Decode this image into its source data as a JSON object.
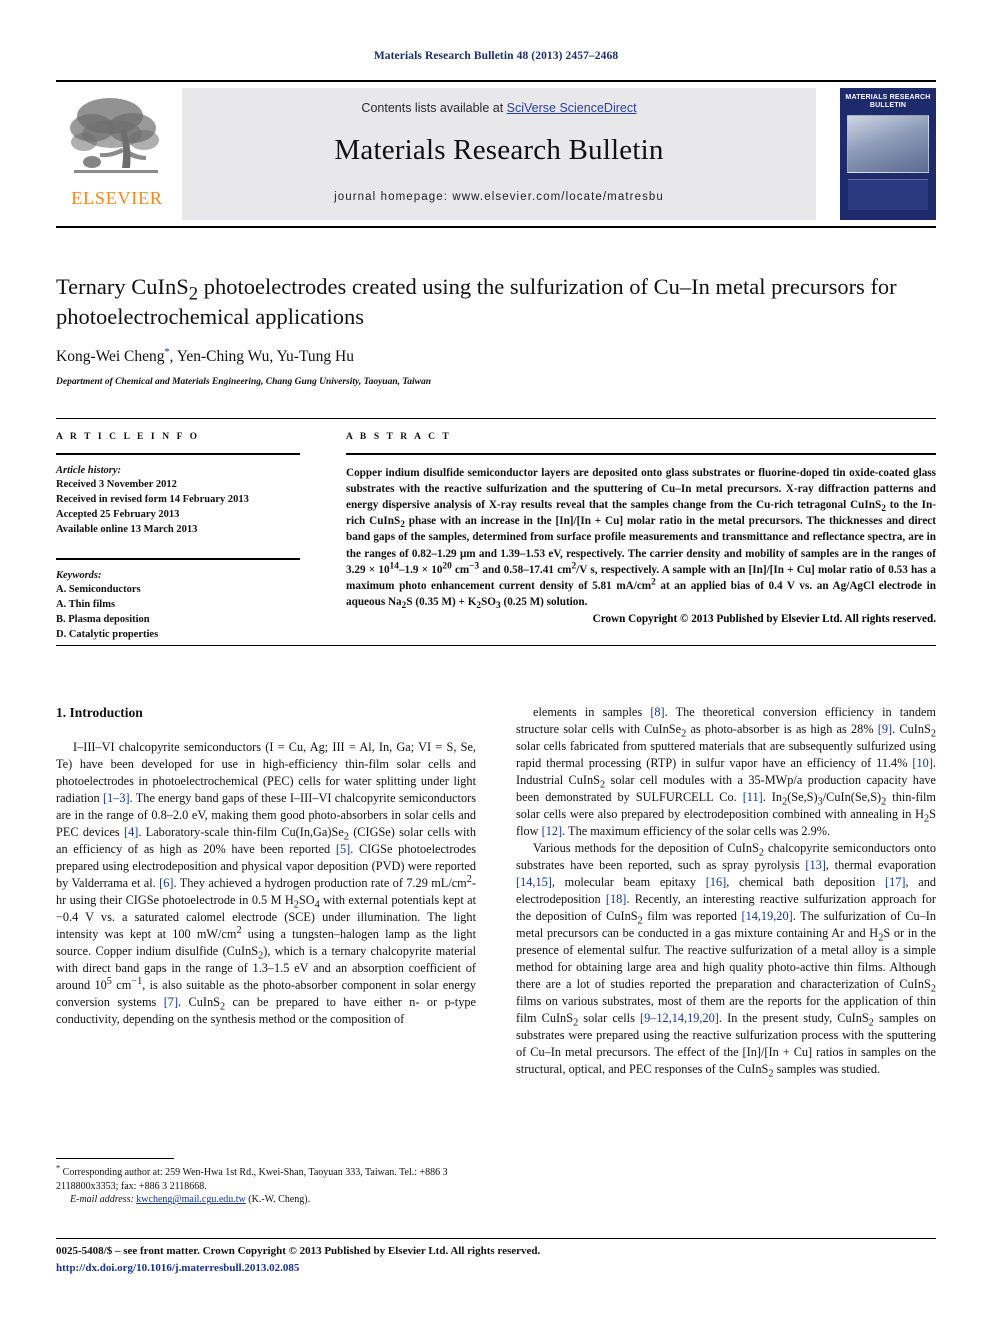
{
  "running_head": "Materials Research Bulletin 48 (2013) 2457–2468",
  "masthead": {
    "contents_prefix": "Contents lists available at ",
    "sciencedirect": "SciVerse ScienceDirect",
    "journal_title": "Materials Research Bulletin",
    "homepage_label": "journal homepage: www.elsevier.com/locate/matresbu",
    "publisher_name": "ELSEVIER",
    "cover_title": "MATERIALS RESEARCH BULLETIN"
  },
  "article": {
    "title_part1": "Ternary CuInS",
    "title_sub": "2",
    "title_part2": " photoelectrodes created using the sulfurization of Cu–In metal precursors for photoelectrochemical applications",
    "authors": "Kong-Wei Cheng",
    "corresponding_marker": "*",
    "authors_rest": ", Yen-Ching Wu, Yu-Tung Hu",
    "affiliation": "Department of Chemical and Materials Engineering, Chang Gung University, Taoyuan, Taiwan"
  },
  "article_info": {
    "heading": "A R T I C L E   I N F O",
    "history_label": "Article history:",
    "history": [
      "Received 3 November 2012",
      "Received in revised form 14 February 2013",
      "Accepted 25 February 2013",
      "Available online 13 March 2013"
    ],
    "keywords_label": "Keywords:",
    "keywords": [
      "A. Semiconductors",
      "A. Thin films",
      "B. Plasma deposition",
      "D. Catalytic properties"
    ]
  },
  "abstract": {
    "heading": "A B S T R A C T",
    "text": "Copper indium disulfide semiconductor layers are deposited onto glass substrates or fluorine-doped tin oxide-coated glass substrates with the reactive sulfurization and the sputtering of Cu–In metal precursors. X-ray diffraction patterns and energy dispersive analysis of X-ray results reveal that the samples change from the Cu-rich tetragonal CuInS2 to the In-rich CuInS2 phase with an increase in the [In]/[In + Cu] molar ratio in the metal precursors. The thicknesses and direct band gaps of the samples, determined from surface profile measurements and transmittance and reflectance spectra, are in the ranges of 0.82–1.29 μm and 1.39–1.53 eV, respectively. The carrier density and mobility of samples are in the ranges of 3.29 × 1014–1.9 × 1020 cm−3 and 0.58–17.41 cm2/V s, respectively. A sample with an [In]/[In + Cu] molar ratio of 0.53 has a maximum photo enhancement current density of 5.81 mA/cm2 at an applied bias of 0.4 V vs. an Ag/AgCl electrode in aqueous Na2S (0.35 M) + K2SO3 (0.25 M) solution.",
    "copyright": "Crown Copyright © 2013 Published by Elsevier Ltd. All rights reserved."
  },
  "intro": {
    "heading": "1. Introduction",
    "left_paragraph": "I–III–VI chalcopyrite semiconductors (I = Cu, Ag; III = Al, In, Ga; VI = S, Se, Te) have been developed for use in high-efficiency thin-film solar cells and photoelectrodes in photoelectrochemical (PEC) cells for water splitting under light radiation [1–3]. The energy band gaps of these I–III–VI chalcopyrite semiconductors are in the range of 0.8–2.0 eV, making them good photo-absorbers in solar cells and PEC devices [4]. Laboratory-scale thin-film Cu(In,Ga)Se2 (CIGSe) solar cells with an efficiency of as high as 20% have been reported [5]. CIGSe photoelectrodes prepared using electrodeposition and physical vapor deposition (PVD) were reported by Valderrama et al. [6]. They achieved a hydrogen production rate of 7.29 mL/cm2-hr using their CIGSe photoelectrode in 0.5 M H2SO4 with external potentials kept at −0.4 V vs. a saturated calomel electrode (SCE) under illumination. The light intensity was kept at 100 mW/cm2 using a tungsten–halogen lamp as the light source. Copper indium disulfide (CuInS2), which is a ternary chalcopyrite material with direct band gaps in the range of 1.3–1.5 eV and an absorption coefficient of around 105 cm−1, is also suitable as the photo-absorber component in solar energy conversion systems [7]. CuInS2 can be prepared to have either n- or p-type conductivity, depending on the synthesis method or the composition of",
    "right_paragraph_1": "elements in samples [8]. The theoretical conversion efficiency in tandem structure solar cells with CuInSe2 as photo-absorber is as high as 28% [9]. CuInS2 solar cells fabricated from sputtered materials that are subsequently sulfurized using rapid thermal processing (RTP) in sulfur vapor have an efficiency of 11.4% [10]. Industrial CuInS2 solar cell modules with a 35-MWp/a production capacity have been demonstrated by SULFURCELL Co. [11]. In2(Se,S)3/CuIn(Se,S)2 thin-film solar cells were also prepared by electrodeposition combined with annealing in H2S flow [12]. The maximum efficiency of the solar cells was 2.9%.",
    "right_paragraph_2": "Various methods for the deposition of CuInS2 chalcopyrite semiconductors onto substrates have been reported, such as spray pyrolysis [13], thermal evaporation [14,15], molecular beam epitaxy [16], chemical bath deposition [17], and electrodeposition [18]. Recently, an interesting reactive sulfurization approach for the deposition of CuInS2 film was reported [14,19,20]. The sulfurization of Cu–In metal precursors can be conducted in a gas mixture containing Ar and H2S or in the presence of elemental sulfur. The reactive sulfurization of a metal alloy is a simple method for obtaining large area and high quality photo-active thin films. Although there are a lot of studies reported the preparation and characterization of CuInS2 films on various substrates, most of them are the reports for the application of thin film CuInS2 solar cells [9–12,14,19,20]. In the present study, CuInS2 samples on substrates were prepared using the reactive sulfurization process with the sputtering of Cu–In metal precursors. The effect of the [In]/[In + Cu] ratios in samples on the structural, optical, and PEC responses of the CuInS2 samples was studied."
  },
  "footnote": {
    "marker": "*",
    "corresponding": "Corresponding author at: 259 Wen-Hwa 1st Rd., Kwei-Shan, Taoyuan 333, Taiwan. Tel.: +886 3 2118800x3353; fax: +886 3 2118668.",
    "email_label": "E-mail address:",
    "email": "kwcheng@mail.cgu.edu.tw",
    "email_owner": "(K.-W. Cheng)."
  },
  "footer": {
    "imprint": "0025-5408/$ – see front matter. Crown Copyright © 2013 Published by Elsevier Ltd. All rights reserved.",
    "doi": "http://dx.doi.org/10.1016/j.materresbull.2013.02.085"
  },
  "colors": {
    "link": "#16348c",
    "runhead": "#1a2f6b",
    "elsevier_orange": "#f08a1c",
    "cover_blue": "#1d2a6b"
  }
}
